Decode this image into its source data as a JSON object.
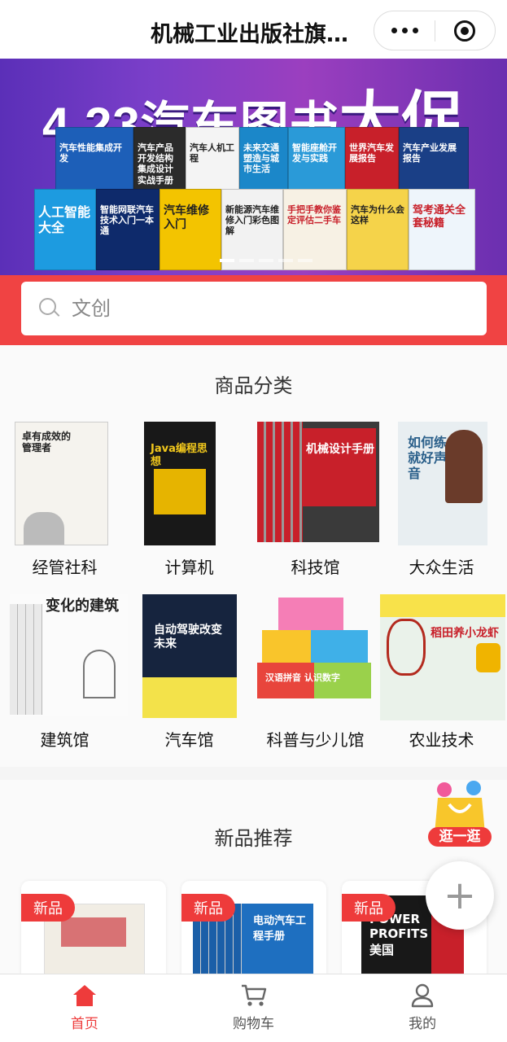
{
  "header": {
    "title": "机械工业出版社旗…"
  },
  "banner": {
    "headline_main": "4.23汽车图书",
    "headline_big": "大促",
    "books": [
      "汽车性能集成开发",
      "汽车产品开发结构集成设计实战手册",
      "汽车人机工程",
      "未来交通塑造与城市生活",
      "智能座舱开发与实践",
      "世界汽车发展报告",
      "人工智能大全",
      "智能网联汽车技术入门一本通",
      "汽车维修入门",
      "新能源汽车维修入门彩色图解",
      "手把手教你鉴定评估二手车",
      "汽车为什么会这样",
      "驾考通关全套秘籍"
    ]
  },
  "search": {
    "placeholder": "文创"
  },
  "categories": {
    "title": "商品分类",
    "items": [
      {
        "label": "经管社科",
        "cover_text": "卓有成效的管理者"
      },
      {
        "label": "计算机",
        "cover_text": "Java编程思想"
      },
      {
        "label": "科技馆",
        "cover_text": "机械设计手册"
      },
      {
        "label": "大众生活",
        "cover_text": "如何练就好声音"
      },
      {
        "label": "建筑馆",
        "cover_text": "变化的建筑"
      },
      {
        "label": "汽车馆",
        "cover_text": "自动驾驶改变未来"
      },
      {
        "label": "科普与少儿馆",
        "cover_text": "汉语拼音 认识数字"
      },
      {
        "label": "农业技术",
        "cover_text": "稻田养小龙虾"
      }
    ]
  },
  "new_products": {
    "title": "新品推荐",
    "badge": "新品",
    "cards": [
      {
        "cover_text": ""
      },
      {
        "cover_text": "电动汽车工程手册"
      },
      {
        "cover_text": "POWER PROFITS 美国"
      }
    ]
  },
  "promo": {
    "label": "逛一逛"
  },
  "fab": {
    "label": "+"
  },
  "tabbar": {
    "items": [
      {
        "label": "首页",
        "icon": "home-icon",
        "active": true
      },
      {
        "label": "购物车",
        "icon": "cart-icon",
        "active": false
      },
      {
        "label": "我的",
        "icon": "user-icon",
        "active": false
      }
    ]
  },
  "colors": {
    "accent": "#ee3b3b",
    "search_bg": "#f04343",
    "banner": "#7b3fc9"
  }
}
